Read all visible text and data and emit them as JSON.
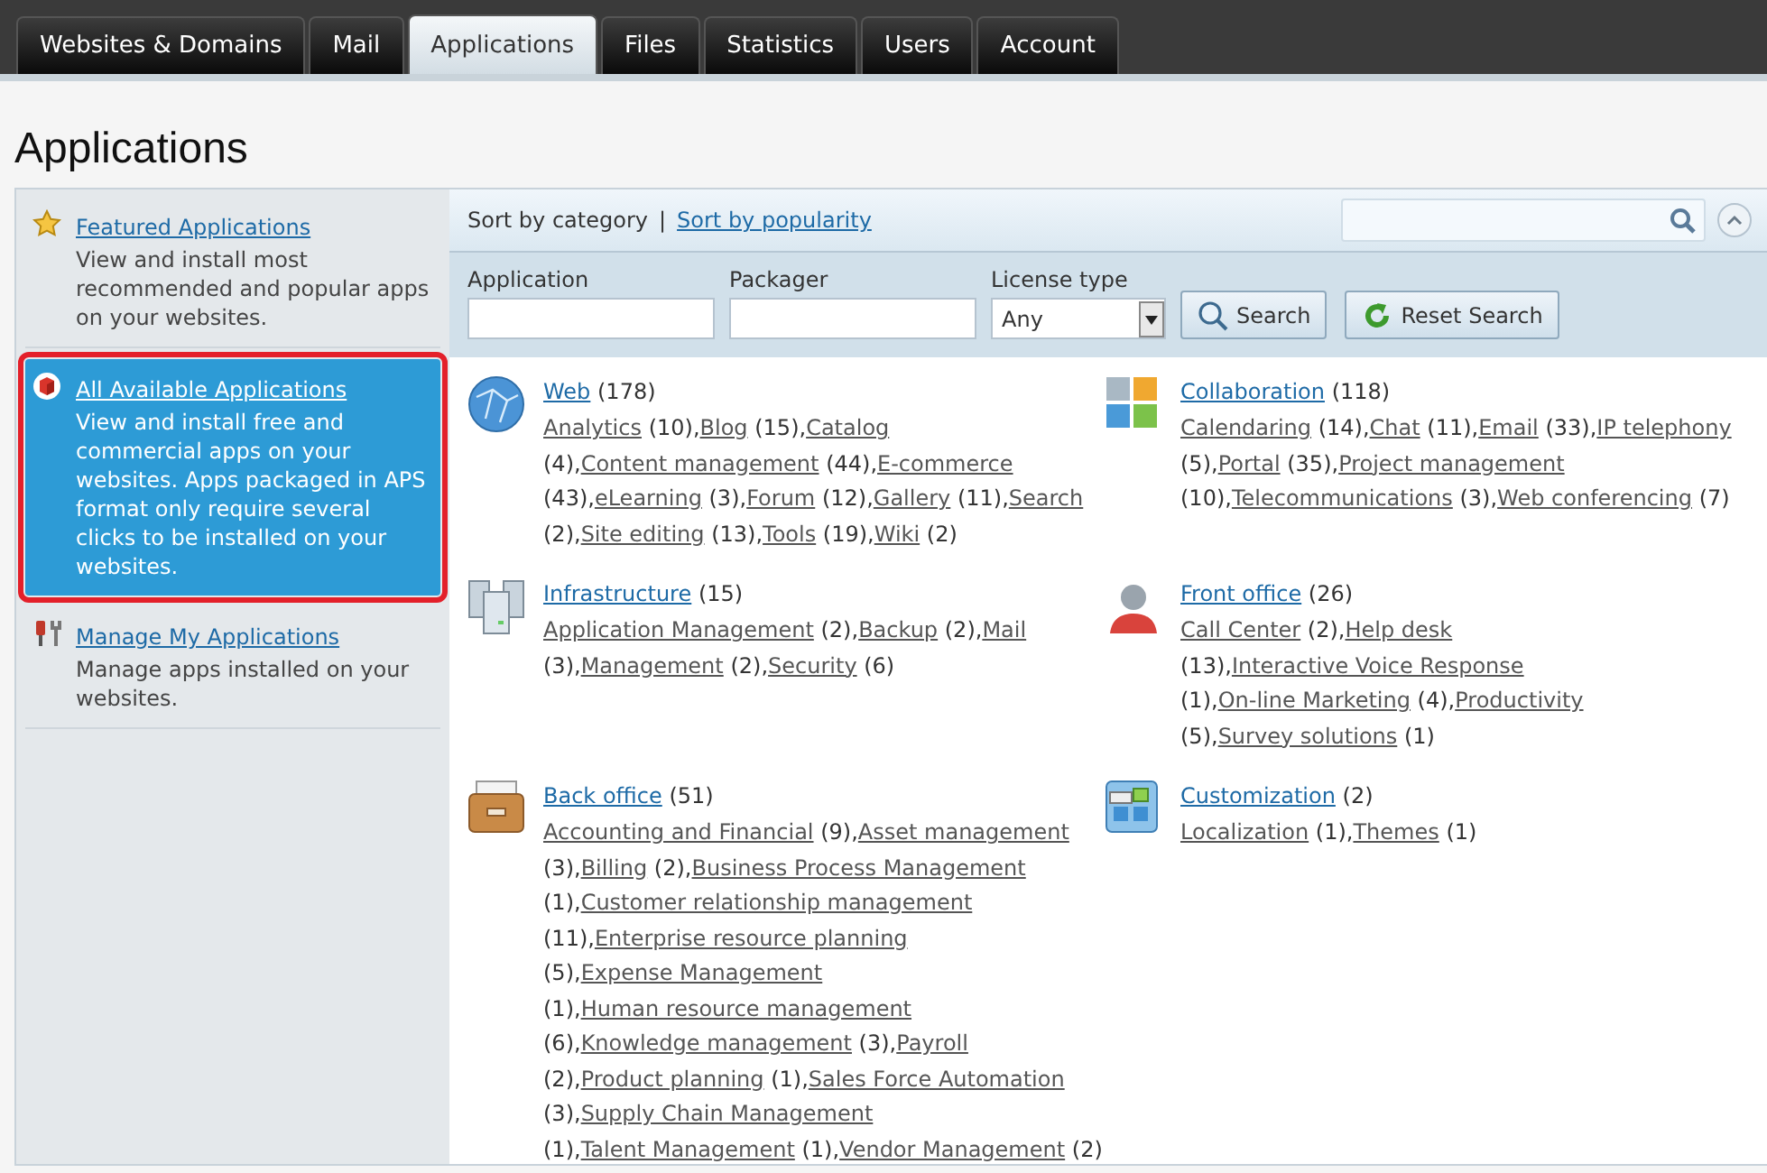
{
  "tabs": [
    {
      "label": "Websites & Domains",
      "selected": false
    },
    {
      "label": "Mail",
      "selected": false
    },
    {
      "label": "Applications",
      "selected": true
    },
    {
      "label": "Files",
      "selected": false
    },
    {
      "label": "Statistics",
      "selected": false
    },
    {
      "label": "Users",
      "selected": false
    },
    {
      "label": "Account",
      "selected": false
    }
  ],
  "page_title": "Applications",
  "sidebar": {
    "items": [
      {
        "kind": "star",
        "title": "Featured Applications",
        "description": "View and install most recommended and popular apps on your websites.",
        "selected": false
      },
      {
        "kind": "cube",
        "title": "All Available Applications",
        "description": "View and install free and commercial apps on your websites. Apps packaged in APS format only require several clicks to be installed on your websites.",
        "selected": true
      },
      {
        "kind": "tools",
        "title": "Manage My Applications",
        "description": "Manage apps installed on your websites.",
        "selected": false
      }
    ]
  },
  "sort": {
    "label": "Sort by category",
    "separator": "|",
    "link": "Sort by popularity"
  },
  "filters": {
    "application_label": "Application",
    "packager_label": "Packager",
    "license_label": "License type",
    "license_value": "Any",
    "search_button": "Search",
    "reset_button": "Reset Search"
  },
  "categories": [
    {
      "kind": "web",
      "title": "Web",
      "count": "(178)",
      "items": [
        {
          "label": "Analytics",
          "count": "(10),"
        },
        {
          "label": "Blog",
          "count": "(15),"
        },
        {
          "label": "Catalog",
          "count": "(4),"
        },
        {
          "label": "Content management",
          "count": "(44),"
        },
        {
          "label": "E-commerce",
          "count": "(43),"
        },
        {
          "label": "eLearning",
          "count": "(3),"
        },
        {
          "label": "Forum",
          "count": "(12),"
        },
        {
          "label": "Gallery",
          "count": "(11),"
        },
        {
          "label": "Search",
          "count": "(2),"
        },
        {
          "label": "Site editing",
          "count": "(13),"
        },
        {
          "label": "Tools",
          "count": "(19),"
        },
        {
          "label": "Wiki",
          "count": "(2)"
        }
      ]
    },
    {
      "kind": "collaboration",
      "title": "Collaboration",
      "count": "(118)",
      "items": [
        {
          "label": "Calendaring",
          "count": "(14),"
        },
        {
          "label": "Chat",
          "count": "(11),"
        },
        {
          "label": "Email",
          "count": "(33),"
        },
        {
          "label": "IP telephony",
          "count": "(5),"
        },
        {
          "label": "Portal",
          "count": "(35),"
        },
        {
          "label": "Project management",
          "count": "(10),"
        },
        {
          "label": "Telecommunications",
          "count": "(3),"
        },
        {
          "label": "Web conferencing",
          "count": "(7)"
        }
      ]
    },
    {
      "kind": "infrastructure",
      "title": "Infrastructure",
      "count": "(15)",
      "items": [
        {
          "label": "Application Management",
          "count": "(2),"
        },
        {
          "label": "Backup",
          "count": "(2),"
        },
        {
          "label": "Mail",
          "count": "(3),"
        },
        {
          "label": "Management",
          "count": "(2),"
        },
        {
          "label": "Security",
          "count": "(6)"
        }
      ]
    },
    {
      "kind": "front",
      "title": "Front office",
      "count": "(26)",
      "items": [
        {
          "label": "Call Center",
          "count": "(2),"
        },
        {
          "label": "Help desk",
          "count": "(13),"
        },
        {
          "label": "Interactive Voice Response",
          "count": "(1),"
        },
        {
          "label": "On-line Marketing",
          "count": "(4),"
        },
        {
          "label": "Productivity",
          "count": "(5),"
        },
        {
          "label": "Survey solutions",
          "count": "(1)"
        }
      ]
    },
    {
      "kind": "back",
      "title": "Back office",
      "count": "(51)",
      "items": [
        {
          "label": "Accounting and Financial",
          "count": "(9),"
        },
        {
          "label": "Asset management",
          "count": "(3),"
        },
        {
          "label": "Billing",
          "count": "(2),"
        },
        {
          "label": "Business Process Management",
          "count": "(1),"
        },
        {
          "label": "Customer relationship management",
          "count": "(11),"
        },
        {
          "label": "Enterprise resource planning",
          "count": "(5),"
        },
        {
          "label": "Expense Management",
          "count": "(1),"
        },
        {
          "label": "Human resource management",
          "count": "(6),"
        },
        {
          "label": "Knowledge management",
          "count": "(3),"
        },
        {
          "label": "Payroll",
          "count": "(2),"
        },
        {
          "label": "Product planning",
          "count": "(1),"
        },
        {
          "label": "Sales Force Automation",
          "count": "(3),"
        },
        {
          "label": "Supply Chain Management",
          "count": "(1),"
        },
        {
          "label": "Talent Management",
          "count": "(1),"
        },
        {
          "label": "Vendor Management",
          "count": "(2)"
        }
      ]
    },
    {
      "kind": "customization",
      "title": "Customization",
      "count": "(2)",
      "items": [
        {
          "label": "Localization",
          "count": "(1),"
        },
        {
          "label": "Themes",
          "count": "(1)"
        }
      ]
    }
  ]
}
